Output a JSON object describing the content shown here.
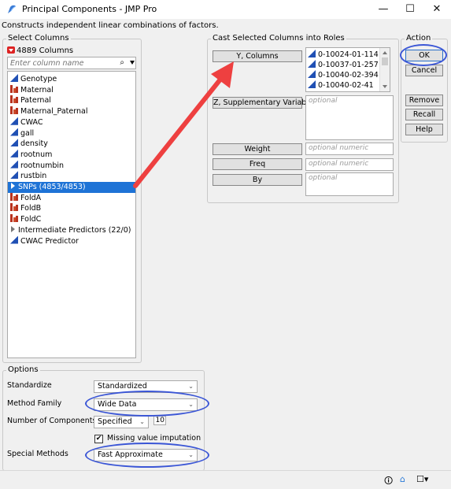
{
  "window": {
    "title": "Principal Components - JMP Pro",
    "minimize": "—",
    "maximize": "☐",
    "close": "✕",
    "subtitle": "Constructs independent linear combinations of factors."
  },
  "select_columns": {
    "group_label": "Select Columns",
    "count_label": "4889 Columns",
    "search_placeholder": "Enter column name",
    "items": [
      {
        "label": "Genotype",
        "icon": "continuous-icon",
        "selected": false
      },
      {
        "label": "Maternal",
        "icon": "nominal-icon",
        "selected": false
      },
      {
        "label": "Paternal",
        "icon": "nominal-icon",
        "selected": false
      },
      {
        "label": "Maternal_Paternal",
        "icon": "nominal-icon",
        "selected": false
      },
      {
        "label": "CWAC",
        "icon": "continuous-icon",
        "selected": false
      },
      {
        "label": "gall",
        "icon": "continuous-icon",
        "selected": false
      },
      {
        "label": "density",
        "icon": "continuous-icon",
        "selected": false
      },
      {
        "label": "rootnum",
        "icon": "continuous-icon",
        "selected": false
      },
      {
        "label": "rootnumbin",
        "icon": "continuous-icon",
        "selected": false
      },
      {
        "label": "rustbin",
        "icon": "continuous-icon",
        "selected": false
      },
      {
        "label": "SNPs (4853/4853)",
        "icon": "expand-triangle-icon",
        "selected": true
      },
      {
        "label": "FoldA",
        "icon": "nominal-icon",
        "selected": false
      },
      {
        "label": "FoldB",
        "icon": "nominal-icon",
        "selected": false
      },
      {
        "label": "FoldC",
        "icon": "nominal-icon",
        "selected": false
      },
      {
        "label": "Intermediate Predictors (22/0)",
        "icon": "expand-triangle-icon",
        "selected": false
      },
      {
        "label": "CWAC Predictor",
        "icon": "continuous-icon",
        "selected": false
      }
    ]
  },
  "cast_roles": {
    "group_label": "Cast Selected Columns into Roles",
    "y_button": "Y, Columns",
    "y_items": [
      "0-10024-01-114",
      "0-10037-01-257",
      "0-10040-02-394",
      "0-10040-02-41"
    ],
    "z_button": "Z, Supplementary Variable",
    "z_placeholder": "optional",
    "weight_button": "Weight",
    "weight_placeholder": "optional numeric",
    "freq_button": "Freq",
    "freq_placeholder": "optional numeric",
    "by_button": "By",
    "by_placeholder": "optional"
  },
  "action": {
    "group_label": "Action",
    "ok": "OK",
    "cancel": "Cancel",
    "remove": "Remove",
    "recall": "Recall",
    "help": "Help"
  },
  "options": {
    "group_label": "Options",
    "standardize_label": "Standardize",
    "standardize_value": "Standardized",
    "method_family_label": "Method Family",
    "method_family_value": "Wide Data",
    "num_components_label": "Number of Components",
    "num_components_mode": "Specified",
    "num_components_value": "10",
    "missing_imputation_label": "Missing value imputation",
    "missing_imputation_checked": true,
    "special_methods_label": "Special Methods",
    "special_methods_value": "Fast Approximate"
  },
  "status_bar": {
    "info_icon": "info-icon",
    "home_icon": "home-icon",
    "window_icon": "window-menu-icon"
  },
  "annotations": {
    "arrow_color": "#ee4040",
    "oval_color": "#3b56d6"
  },
  "colors": {
    "selection": "#1e73d6",
    "continuous_icon": "#2050b4",
    "nominal_icon": "#b8321e"
  }
}
